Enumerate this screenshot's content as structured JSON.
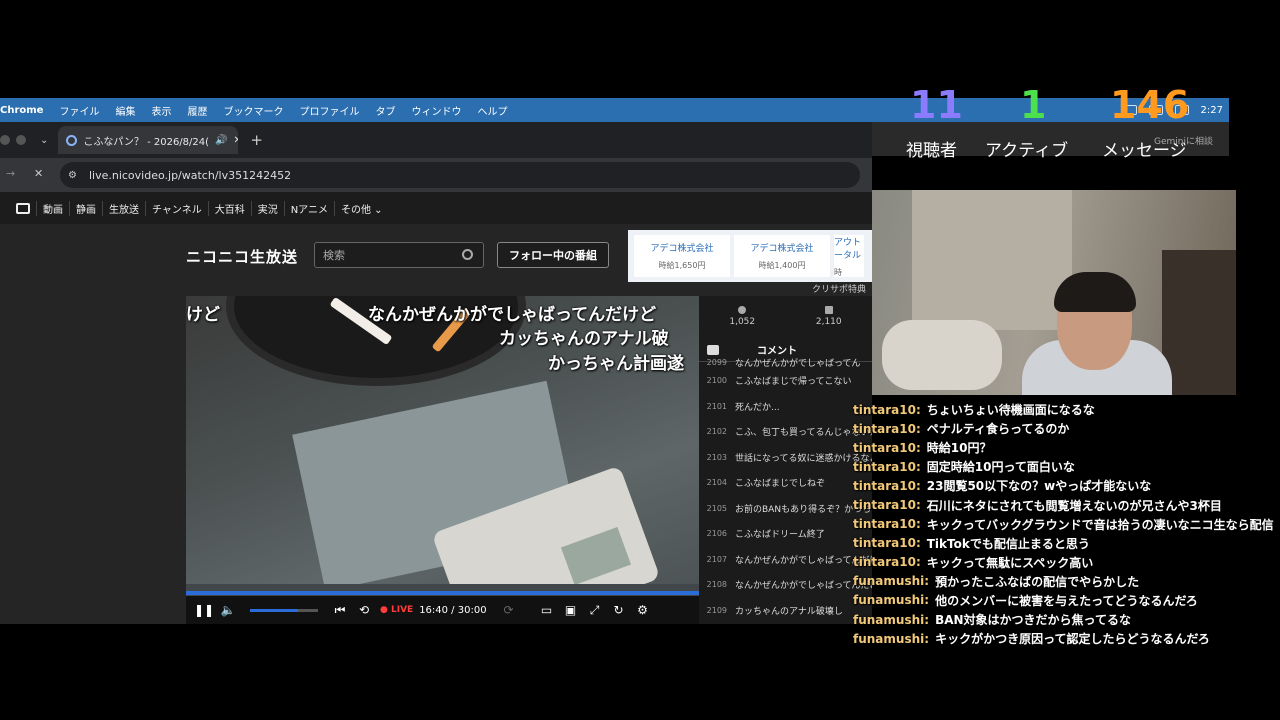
{
  "menubar": {
    "app": "Chrome",
    "items": [
      "ファイル",
      "編集",
      "表示",
      "履歴",
      "ブックマーク",
      "プロファイル",
      "タブ",
      "ウィンドウ",
      "ヘルプ"
    ],
    "clock": "2:27"
  },
  "tab": {
    "title": "こふなパン？ - 2026/8/24("
  },
  "address": {
    "url": "live.nicovideo.jp/watch/lv351242452"
  },
  "bookmarks": [
    "動画",
    "静画",
    "生放送",
    "チャンネル",
    "大百科",
    "実況",
    "Nアニメ",
    "その他 ⌄"
  ],
  "site": {
    "logo": "ニコニコ生放送",
    "search_placeholder": "検索",
    "follow_button": "フォロー中の番組"
  },
  "ads": [
    {
      "company": "アデコ株式会社",
      "wage": "時給1,650円"
    },
    {
      "company": "アデコ株式会社",
      "wage": "時給1,400円"
    },
    {
      "company": "アウト ータル",
      "wage": "時"
    }
  ],
  "tooltip": "クリサポ特典",
  "video": {
    "danmaku": [
      "けど",
      "なんかぜんかがでしゃばってんだけど",
      "カッちゃんのアナル破",
      "かっちゃん計画遂"
    ],
    "live_label": "● LIVE",
    "time": "16:40 / 30:00",
    "progress_fraction": 1.0,
    "volume_fraction": 0.7
  },
  "comment_panel": {
    "viewers": "1,052",
    "comments": "2,110",
    "tab_label": "コメント",
    "rows": [
      {
        "no": "2099",
        "text": "なんかぜんかがでしゃばってん"
      },
      {
        "no": "2100",
        "text": "こふなばまじで帰ってこない"
      },
      {
        "no": "2101",
        "text": "死んだか..."
      },
      {
        "no": "2102",
        "text": "こふ、包丁も買ってるんじゃないか？"
      },
      {
        "no": "2103",
        "text": "世話になってる奴に迷惑かけるなよ"
      },
      {
        "no": "2104",
        "text": "こふなばまじでしねぞ"
      },
      {
        "no": "2105",
        "text": "お前のBANもあり得るぞ？かっちゃん"
      },
      {
        "no": "2106",
        "text": "こふなばドリーム終了"
      },
      {
        "no": "2107",
        "text": "なんかぜんかがでしゃばってんだけど"
      },
      {
        "no": "2108",
        "text": "なんかぜんかがでしゃばってんだけど"
      },
      {
        "no": "2109",
        "text": "カッちゃんのアナル破壊し"
      }
    ]
  },
  "overlay_stats": [
    {
      "value": "11",
      "label": "視聴者",
      "color": "#8b7bff"
    },
    {
      "value": "1",
      "label": "アクティブ",
      "color": "#4ce04c"
    },
    {
      "value": "146",
      "label": "メッセージ",
      "color": "#ff9a1e"
    }
  ],
  "gemini": "Geminiに相談",
  "chat": [
    {
      "user": "tintara10:",
      "msg": "ちょいちょい待機画面になるな",
      "color": "#f2c879"
    },
    {
      "user": "tintara10:",
      "msg": "ペナルティ食らってるのか",
      "color": "#f2c879"
    },
    {
      "user": "tintara10:",
      "msg": "時給10円？",
      "color": "#f2c879"
    },
    {
      "user": "tintara10:",
      "msg": "固定時給10円って面白いな",
      "color": "#f2c879"
    },
    {
      "user": "tintara10:",
      "msg": "23閲覧50以下なの？wやっぱ才能ないな",
      "color": "#f2c879"
    },
    {
      "user": "tintara10:",
      "msg": "石川にネタにされても閲覧増えないのが兄さんや3杯目",
      "color": "#f2c879"
    },
    {
      "user": "tintara10:",
      "msg": "キックってバックグラウンドで音は拾うの凄いなニコ生なら配信",
      "color": "#f2c879"
    },
    {
      "user": "tintara10:",
      "msg": "TikTokでも配信止まると思う",
      "color": "#f2c879"
    },
    {
      "user": "tintara10:",
      "msg": "キックって無駄にスペック高い",
      "color": "#f2c879"
    },
    {
      "user": "funamushi:",
      "msg": "預かったこふなばの配信でやらかした",
      "color": "#f2c879"
    },
    {
      "user": "funamushi:",
      "msg": "他のメンバーに被害を与えたってどうなるんだろ",
      "color": "#f2c879"
    },
    {
      "user": "funamushi:",
      "msg": "BAN対象はかつきだから焦ってるな",
      "color": "#f2c879"
    },
    {
      "user": "funamushi:",
      "msg": "キックがかつき原因って認定したらどうなるんだろ",
      "color": "#f2c879"
    }
  ]
}
